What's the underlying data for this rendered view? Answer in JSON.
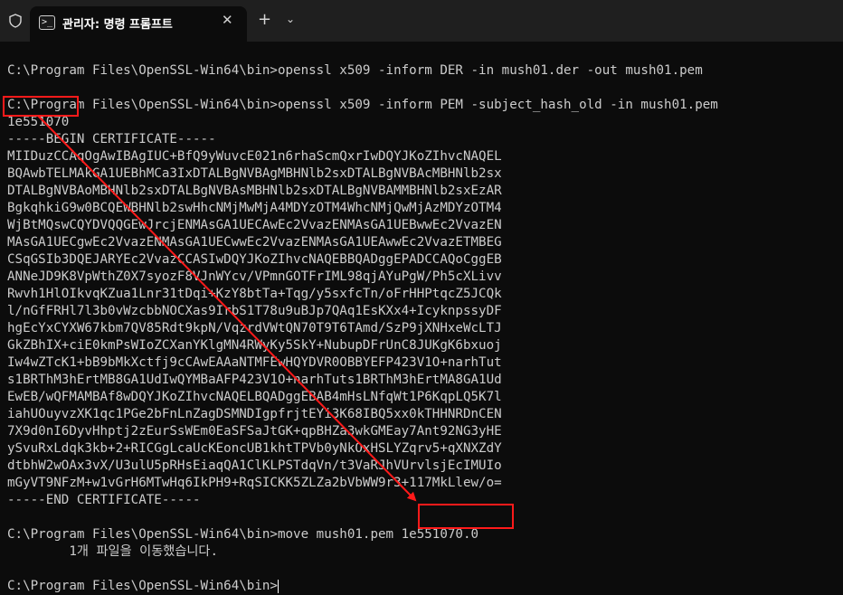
{
  "window": {
    "tab_title": "관리자: 명령 프롬프트",
    "tab_icon_text": ">_",
    "close_symbol": "✕",
    "new_tab_symbol": "+",
    "dropdown_symbol": "⌄"
  },
  "terminal": {
    "lines": [
      "",
      "C:\\Program Files\\OpenSSL-Win64\\bin>openssl x509 -inform DER -in mush01.der -out mush01.pem",
      "",
      "C:\\Program Files\\OpenSSL-Win64\\bin>openssl x509 -inform PEM -subject_hash_old -in mush01.pem",
      "1e551070",
      "-----BEGIN CERTIFICATE-----",
      "MIIDuzCCAqOgAwIBAgIUC+BfQ9yWuvcE021n6rhaScmQxrIwDQYJKoZIhvcNAQEL",
      "BQAwbTELMAkGA1UEBhMCa3IxDTALBgNVBAgMBHNlb2sxDTALBgNVBAcMBHNlb2sx",
      "DTALBgNVBAoMBHNlb2sxDTALBgNVBAsMBHNlb2sxDTALBgNVBAMMBHNlb2sxEzAR",
      "BgkqhkiG9w0BCQEWBHNlb2swHhcNMjMwMjA4MDYzOTM4WhcNMjQwMjAzMDYzOTM4",
      "WjBtMQswCQYDVQQGEwJrcjENMAsGA1UECAwEc2VvazENMAsGA1UEBwwEc2VvazEN",
      "MAsGA1UECgwEc2VvazENMAsGA1UECwwEc2VvazENMAsGA1UEAwwEc2VvazETMBEG",
      "CSqGSIb3DQEJARYEc2VvazCCASIwDQYJKoZIhvcNAQEBBQADggEPADCCAQoCggEB",
      "ANNeJD9K8VpWthZ0X7syozF8VJnWYcv/VPmnGOTFrIML98qjAYuPgW/Ph5cXLivv",
      "Rwvh1HlOIkvqKZua1Lnr31tDqi+KzY8btTa+Tqg/y5sxfcTn/oFrHHPtqcZ5JCQk",
      "l/nGfFRHl7l3b0vWzcbbNOCXas9IrbS1T78u9uBJp7QAq1EsKXx4+IcyknpssyDF",
      "hgEcYxCYXW67kbm7QV85Rdt9kpN/VqzrdVWtQN70T9T6TAmd/SzP9jXNHxeWcLTJ",
      "GkZBhIX+ciE0kmPsWIoZCXanYKlgMN4RWyKy5SkY+NubupDFrUnC8JUKgK6bxuoj",
      "Iw4wZTcK1+bB9bMkXctfj9cCAwEAAaNTMFEwHQYDVR0OBBYEFP423V1O+narhTut",
      "s1BRThM3hErtMB8GA1UdIwQYMBaAFP423V1O+narhTuts1BRThM3hErtMA8GA1Ud",
      "EwEB/wQFMAMBAf8wDQYJKoZIhvcNAQELBQADggEBAB4mHsLNfqWt1P6KqpLQ5K7l",
      "iahUOuyvzXK1qc1PGe2bFnLnZagDSMNDIgpfrjtEYi3K68IBQ5xx0kTHHNRDnCEN",
      "7X9d0nI6DyvHhptj2zEurSsWEm0EaSFSaJtGK+qpBHZa3wkGMEay7Ant92NG3yHE",
      "ySvuRxLdqk3kb+2+RICGgLcaUcKEoncUB1khtTPVb0yNkOxHSLYZqrv5+qXNXZdY",
      "dtbhW2wOAx3vX/U3ulU5pRHsEiaqQA1ClKLPSTdqVn/t3VaRJhVUrvlsjEcIMUIo",
      "mGyVT9NFzM+w1vGrH6MTwHq6IkPH9+RqSICKK5ZLZa2bVbWW9r3+117MkLlew/o=",
      "-----END CERTIFICATE-----",
      "",
      "C:\\Program Files\\OpenSSL-Win64\\bin>move mush01.pem 1e551070.0",
      "        1개 파일을 이동했습니다.",
      "",
      "C:\\Program Files\\OpenSSL-Win64\\bin>"
    ]
  },
  "annotations": {
    "highlight_color": "#ff1a1a",
    "source_text": "1e551070",
    "target_text": "1e551070.0"
  }
}
